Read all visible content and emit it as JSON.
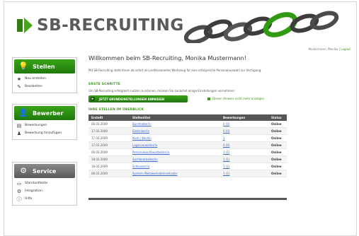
{
  "header": {
    "brand": "SB-RECRUITING",
    "user_label": "Mustermann, Monika",
    "logout": "Logout"
  },
  "sidebar": {
    "stellen": {
      "title": "Stellen",
      "items": [
        {
          "label": "Neu erstellen",
          "icon": "star-icon"
        },
        {
          "label": "Bearbeiten",
          "icon": "pencil-icon"
        }
      ]
    },
    "bewerber": {
      "title": "Bewerber",
      "items": [
        {
          "label": "Bewerbungen",
          "icon": "inbox-icon"
        },
        {
          "label": "Bewerbung hinzufügen",
          "icon": "user-add-icon"
        }
      ]
    },
    "service": {
      "title": "Service",
      "items": [
        {
          "label": "Standardtexte",
          "icon": "document-icon"
        },
        {
          "label": "Integration",
          "icon": "gear-icon"
        },
        {
          "label": "Hilfe",
          "icon": "help-icon"
        }
      ]
    }
  },
  "main": {
    "welcome": "Willkommen beim SB-Recruiting, Monika Mustermann!",
    "intro": "Mit SB-Recruiting steht Ihnen ab sofort ein professionelles Werkzeug für eine erfolgreiche Personalauswahl zur Verfügung.",
    "first_steps_title": "ERSTE SCHRITTE",
    "first_steps_text": "Um SB-Recruiting erfolgreich nutzen zu können, müssen Sie zunächst einige Einstellungen vornehmen:",
    "button_label": "JETZT GRUNDEINSTELLUNGEN ANPASSEN",
    "hide_link": "Diesen Hinweis nicht mehr anzeigen",
    "table_title": "IHRE STELLEN IM ÜBERBLICK",
    "columns": [
      "Erstellt",
      "Stellentitel",
      "Bewerbungen",
      "Status"
    ],
    "rows": [
      [
        "06.03.2009",
        "Buchhalter/in",
        "0 (0)",
        "Online"
      ],
      [
        "17.03.2009",
        "Elektriker/in",
        "0 (0)",
        "Online"
      ],
      [
        "17.03.2009",
        "Koch / Köchin",
        "1",
        "Online"
      ],
      [
        "17.03.2009",
        "Lagerverwalter/in",
        "0 (0)",
        "Online"
      ],
      [
        "06.03.2009",
        "Personalsachbearbeiter/in",
        "1 (1)",
        "Online"
      ],
      [
        "18.03.2009",
        "Sachbearbeiter/in",
        "1 (1)",
        "Online"
      ],
      [
        "18.03.2009",
        "Schlosser/in",
        "1 (1)",
        "Online"
      ],
      [
        "06.03.2009",
        "System-/Netzwerkadministrator",
        "1 (1)",
        "Online"
      ]
    ]
  }
}
